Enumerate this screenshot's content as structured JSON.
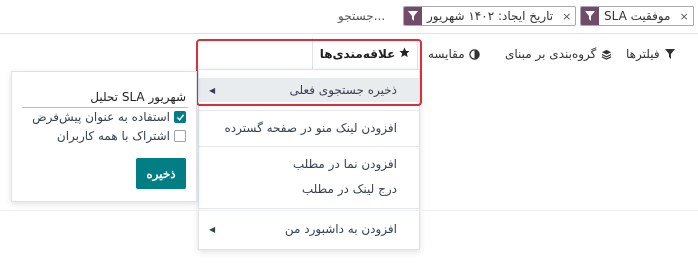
{
  "search": {
    "facets": [
      {
        "label": "SLA موفقیت"
      },
      {
        "label": "تاریخ ایجاد: ۱۴۰۲ شهریور"
      }
    ],
    "placeholder": "جستجو..."
  },
  "toolbar": {
    "filters_label": "فیلترها",
    "groupby_label": "گروه‌بندی بر مبنای",
    "compare_label": "مقایسه",
    "favorites_label": "علاقه‌مندی‌ها"
  },
  "favorites_menu": {
    "items": [
      {
        "label": "ذخیره جستجوی فعلی",
        "submenu": true
      },
      {
        "label": "افزودن لینک منو در صفحه گسترده",
        "submenu": false
      },
      {
        "label": "افزودن نما در مطلب",
        "submenu": false
      },
      {
        "label": "درج لینک در مطلب",
        "submenu": false
      },
      {
        "label": "افزودن به داشبورد من",
        "submenu": true
      }
    ]
  },
  "save_panel": {
    "name_value": "تحلیل SLA شهریور",
    "use_default_label": "استفاده به عنوان پیش‌فرض",
    "use_default_checked": true,
    "share_label": "اشتراک با همه کاربران",
    "share_checked": false,
    "save_button_label": "ذخیره"
  },
  "colors": {
    "facet_icon_bg": "#714b67",
    "primary_button": "#017e84",
    "highlight_border": "#d9303a"
  }
}
